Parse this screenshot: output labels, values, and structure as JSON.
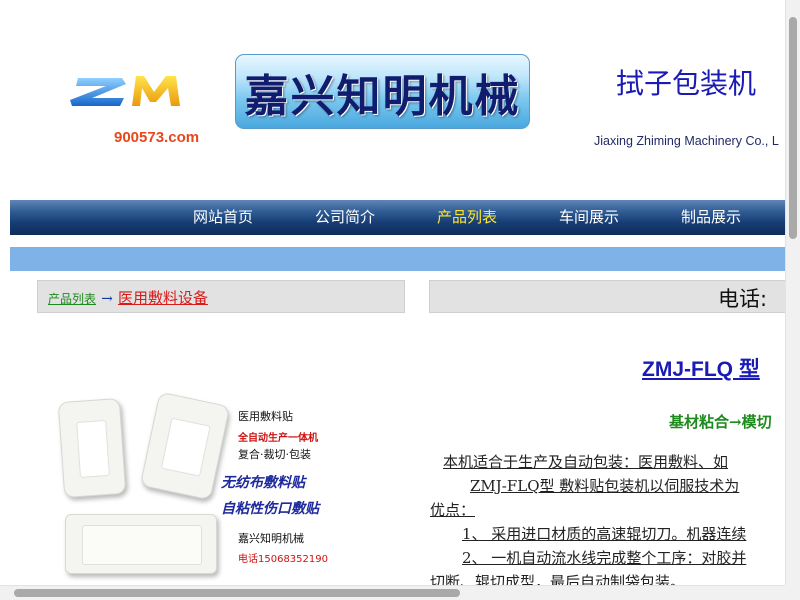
{
  "header": {
    "logo_text": "ZM",
    "site_url": "900573.com",
    "brand_name": "嘉兴知明机械",
    "title": "拭子包装机",
    "company_en": "Jiaxing Zhiming Machinery Co., L"
  },
  "nav": {
    "items": [
      {
        "label": "网站首页",
        "active": false
      },
      {
        "label": "公司简介",
        "active": false
      },
      {
        "label": "产品列表",
        "active": true
      },
      {
        "label": "车间展示",
        "active": false
      },
      {
        "label": "制品展示",
        "active": false
      }
    ]
  },
  "breadcrumb": {
    "parent": "产品列表",
    "arrow": "→",
    "current": "医用敷料设备"
  },
  "phone": {
    "label": "电话:"
  },
  "product_image": {
    "line1": "医用敷料贴",
    "line2": "全自动生产一体机",
    "line3": "复合·裁切·包装",
    "line4": "无纺布敷料贴",
    "line5": "自粘性伤口敷贴",
    "line6": "嘉兴知明机械",
    "line7": "电话15068352190"
  },
  "product": {
    "title": "ZMJ-FLQ 型",
    "process": "基材粘合→模切",
    "desc_line1": "本机适合于生产及自动包装：医用敷料、如",
    "desc_line2": "ZMJ-FLQ型 敷料贴包装机以伺服技术为",
    "desc_line3": "优点：",
    "desc_line4": "1、 采用进口材质的高速辊切刀。机器连续",
    "desc_line5": "2、 一机自动流水线完成整个工序：对胶并",
    "desc_line6": "切断、辊切成型，最后自动制袋包装。"
  },
  "colors": {
    "nav_active": "#ffe62e",
    "nav_text": "#ffffff",
    "title_blue": "#1a1ab5",
    "green": "#1e8a1e",
    "red": "#d81b1b"
  }
}
